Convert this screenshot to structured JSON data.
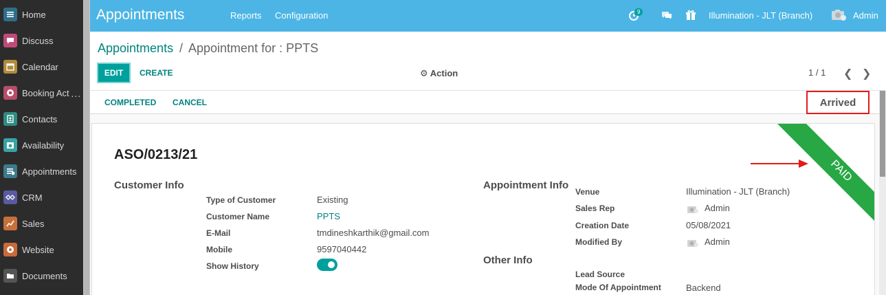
{
  "sidebar": {
    "items": [
      {
        "label": "Home",
        "icon": "home-icon",
        "color": "#2f6e8a"
      },
      {
        "label": "Discuss",
        "icon": "discuss-icon",
        "color": "#c04a7a"
      },
      {
        "label": "Calendar",
        "icon": "calendar-icon",
        "color": "#b08b3a"
      },
      {
        "label": "Booking Act",
        "icon": "booking-icon",
        "color": "#b84d6a"
      },
      {
        "label": "Contacts",
        "icon": "contacts-icon",
        "color": "#2e8c82"
      },
      {
        "label": "Availability",
        "icon": "availability-icon",
        "color": "#3aa3a3"
      },
      {
        "label": "Appointments",
        "icon": "appointments-icon",
        "color": "#3d7a8a"
      },
      {
        "label": "CRM",
        "icon": "crm-icon",
        "color": "#5a5aa0"
      },
      {
        "label": "Sales",
        "icon": "sales-icon",
        "color": "#c8703a"
      },
      {
        "label": "Website",
        "icon": "website-icon",
        "color": "#c86a3a"
      },
      {
        "label": "Documents",
        "icon": "documents-icon",
        "color": "#555555"
      }
    ],
    "more_dots": "..."
  },
  "topbar": {
    "app_title": "Appointments",
    "menu": [
      "Reports",
      "Configuration"
    ],
    "activity_count": "9",
    "company": "Illumination - JLT (Branch)",
    "user": "Admin"
  },
  "control": {
    "breadcrumb_parent": "Appointments",
    "breadcrumb_sep": "/",
    "breadcrumb_current": "Appointment for : PPTS",
    "edit_label": "EDIT",
    "create_label": "CREATE",
    "action_label": "Action",
    "pager": "1 / 1",
    "pager_prev": "❮",
    "pager_next": "❯"
  },
  "statusbar": {
    "completed_label": "COMPLETED",
    "cancel_label": "CANCEL",
    "state": "Arrived"
  },
  "sheet": {
    "reference": "ASO/0213/21",
    "ribbon_text": "PAID",
    "ribbon_color": "#28a745",
    "customer_info": {
      "title": "Customer Info",
      "type_label": "Type of Customer",
      "type_value": "Existing",
      "name_label": "Customer Name",
      "name_value": "PPTS",
      "email_label": "E-Mail",
      "email_value": "tmdineshkarthik@gmail.com",
      "mobile_label": "Mobile",
      "mobile_value": "9597040442",
      "history_label": "Show History"
    },
    "appointment_info": {
      "title": "Appointment Info",
      "venue_label": "Venue",
      "venue_value": "Illumination - JLT (Branch)",
      "sales_rep_label": "Sales Rep",
      "sales_rep_value": "Admin",
      "creation_label": "Creation Date",
      "creation_value": "05/08/2021",
      "modified_label": "Modified By",
      "modified_value": "Admin"
    },
    "other_info": {
      "title": "Other Info",
      "lead_label": "Lead Source",
      "mode_label": "Mode Of Appointment",
      "mode_value": "Backend"
    }
  },
  "colors": {
    "topbar": "#4cb5e5",
    "accent": "#00a09d",
    "link": "#00837f",
    "sidebar": "#2c2c2c",
    "highlight": "#e31b1b"
  }
}
